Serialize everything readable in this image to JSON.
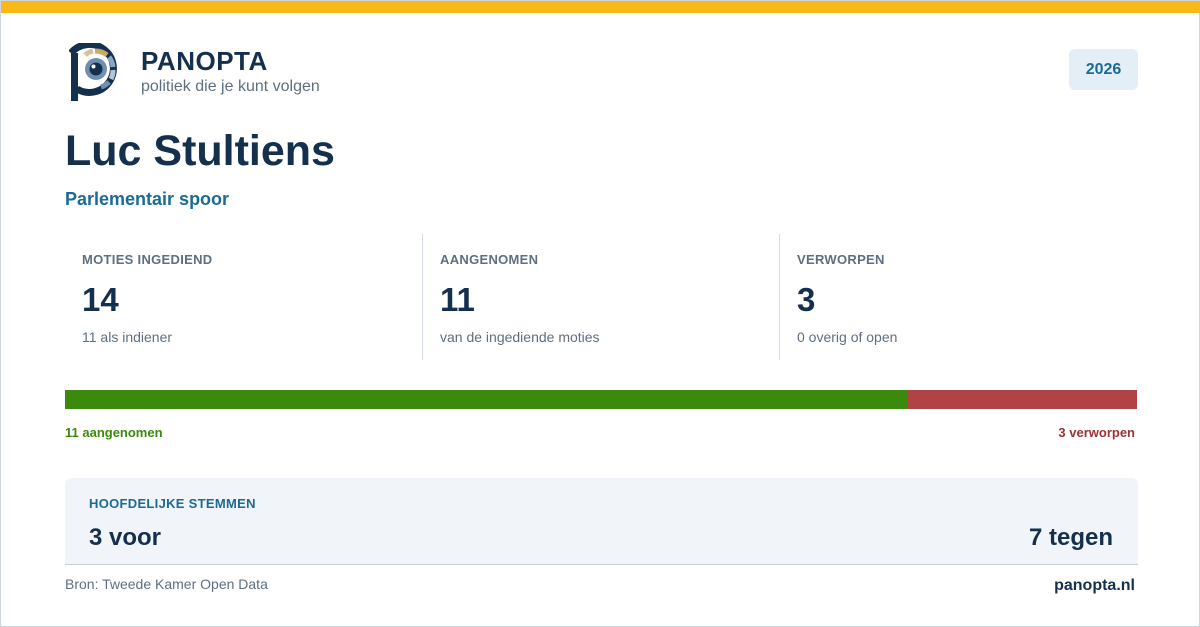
{
  "brand": {
    "name": "PANOPTA",
    "tagline": "politiek die je kunt volgen",
    "icon": "panopta-eye-logo-icon"
  },
  "year": "2026",
  "person": {
    "name": "Luc Stultiens",
    "track": "Parlementair spoor"
  },
  "stats": [
    {
      "label": "MOTIES INGEDIEND",
      "value": "14",
      "note": "11 als indiener"
    },
    {
      "label": "AANGENOMEN",
      "value": "11",
      "note": "van de ingediende moties"
    },
    {
      "label": "VERWORPEN",
      "value": "3",
      "note": "0 overig of open"
    }
  ],
  "result_bar": {
    "adopted": 11,
    "rejected": 3,
    "adopted_label": "11 aangenomen",
    "rejected_label": "3 verworpen"
  },
  "votes": {
    "heading": "HOOFDELIJKE STEMMEN",
    "for": "3 voor",
    "against": "7 tegen"
  },
  "footer": {
    "source": "Bron: Tweede Kamer Open Data",
    "site": "panopta.nl"
  },
  "colors": {
    "accent_stripe": "#f8b818",
    "navy": "#14304d",
    "link_blue": "#1a6b96",
    "adopted_green": "#3b8a0e",
    "rejected_red": "#b04444"
  }
}
